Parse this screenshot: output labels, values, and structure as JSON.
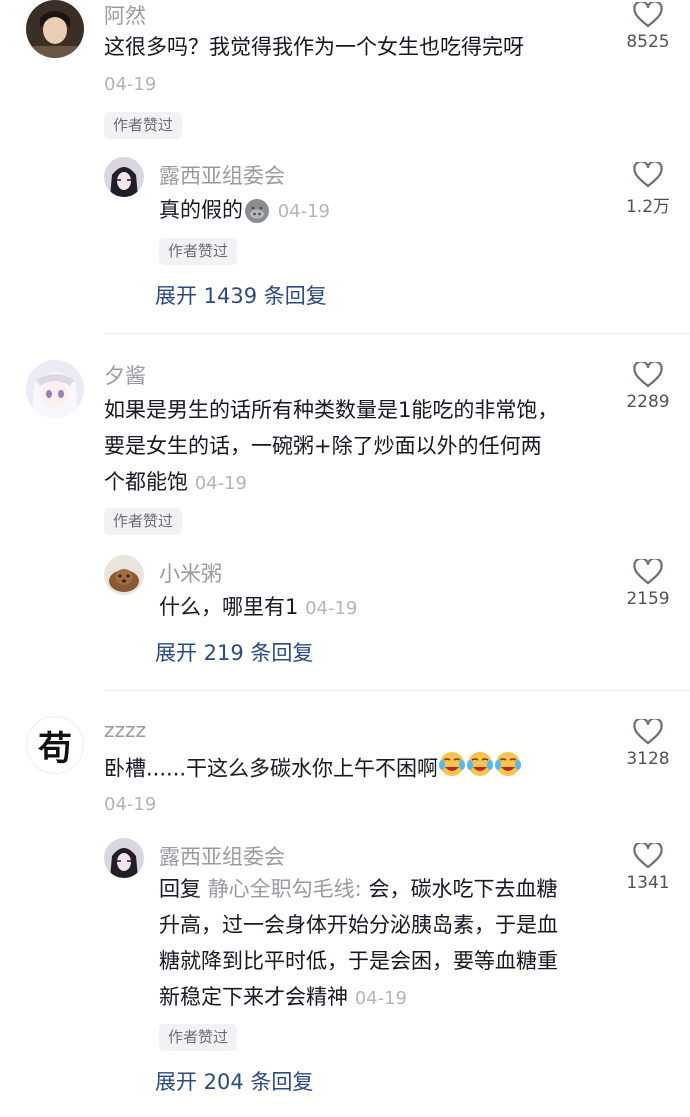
{
  "comments": [
    {
      "name": "阿然",
      "text": [
        "这很多吗？我觉得我作为一个女生也吃得完呀"
      ],
      "date": "04-19",
      "badge": "作者赞过",
      "likes": "8525",
      "reply": {
        "name": "露西亚组委会",
        "text": "真的假的",
        "emoji": "pig-nose-emoji",
        "date": "04-19",
        "badge": "作者赞过",
        "likes": "1.2万"
      },
      "expand": "展开 1439 条回复"
    },
    {
      "name": "夕酱",
      "text": [
        "如果是男生的话所有种类数量是1能吃的非常饱，",
        "要是女生的话，一碗粥+除了炒面以外的任何两",
        "个都能饱"
      ],
      "date": "04-19",
      "badge": "作者赞过",
      "likes": "2289",
      "reply": {
        "name": "小米粥",
        "text": "什么，哪里有1",
        "date": "04-19",
        "likes": "2159"
      },
      "expand": "展开 219 条回复"
    },
    {
      "name": "zzzz",
      "avatar_char": "苟",
      "text": [
        "卧槽......干这么多碳水你上午不困啊"
      ],
      "emoji": "crying-laughing-emoji",
      "date": "04-19",
      "likes": "3128",
      "reply": {
        "name": "露西亚组委会",
        "prefix": "回复",
        "reply_to": "静心全职勾毛线:",
        "text": [
          "会，碳水吃下去血糖",
          "升高，过一会身体开始分泌胰岛素，于是血",
          "糖就降到比平时低，于是会困，要等血糖重",
          "新稳定下来才会精神"
        ],
        "date": "04-19",
        "badge": "作者赞过",
        "likes": "1341"
      },
      "expand": "展开 204 条回复"
    }
  ]
}
